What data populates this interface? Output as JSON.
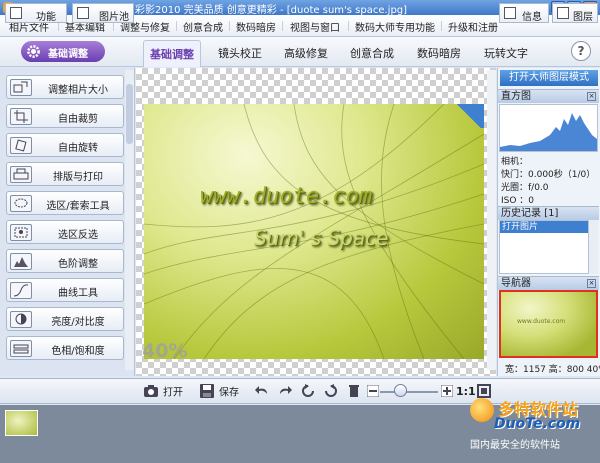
{
  "titlebar": {
    "title": "彩影2010  完美品质  创意更精彩  - [duote sum's space.jpg]",
    "min": "_",
    "max": "□",
    "close": "×"
  },
  "menu": [
    "相片文件",
    "基本编辑",
    "调整与修复",
    "创意合成",
    "数码暗房",
    "视图与窗口",
    "数码大师专用功能",
    "升级和注册"
  ],
  "tabbar": {
    "mode_button": "基础调整",
    "tabs": [
      "基础调整",
      "镜头校正",
      "高级修复",
      "创意合成",
      "数码暗房",
      "玩转文字"
    ],
    "active_tab": "基础调整",
    "help": "?"
  },
  "tools": [
    "调整相片大小",
    "自由裁剪",
    "自由旋转",
    "排版与打印",
    "选区/套索工具",
    "选区反选",
    "色阶调整",
    "曲线工具",
    "亮度/对比度",
    "色相/饱和度"
  ],
  "canvas": {
    "watermark_line1": "www.duote.com",
    "watermark_line2": "Sum' s Space",
    "zoom_label": "40%"
  },
  "rightpanel": {
    "layers_button": "打开大师图层模式",
    "histogram_title": "直方图",
    "camera_label": "相机：",
    "shutter": "快门：0.000秒（1/0）",
    "aperture": "光圈：f/0.0",
    "iso": "ISO  ：0",
    "history_title": "历史记录 [1]",
    "history_items": [
      "打开图片"
    ],
    "navigator_title": "导航器",
    "navigator_text": "www.duote.com",
    "size_info": "宽：1157  高：800  40%"
  },
  "bottombar": {
    "function_label": "功能",
    "gallery_label": "图片池",
    "open_label": "打开",
    "save_label": "保存",
    "ratio_label": "1:1",
    "info_label": "信息",
    "layers_label": "图层"
  },
  "brand": {
    "line1": "多特软件站",
    "line2": "DuoTe.com",
    "line3": "国内最安全的软件站"
  },
  "colors": {
    "title_blue": "#3f78c9",
    "accent_purple": "#6a3fb0",
    "selection_blue": "#3f7fd0",
    "navigator_border": "#e03020"
  }
}
